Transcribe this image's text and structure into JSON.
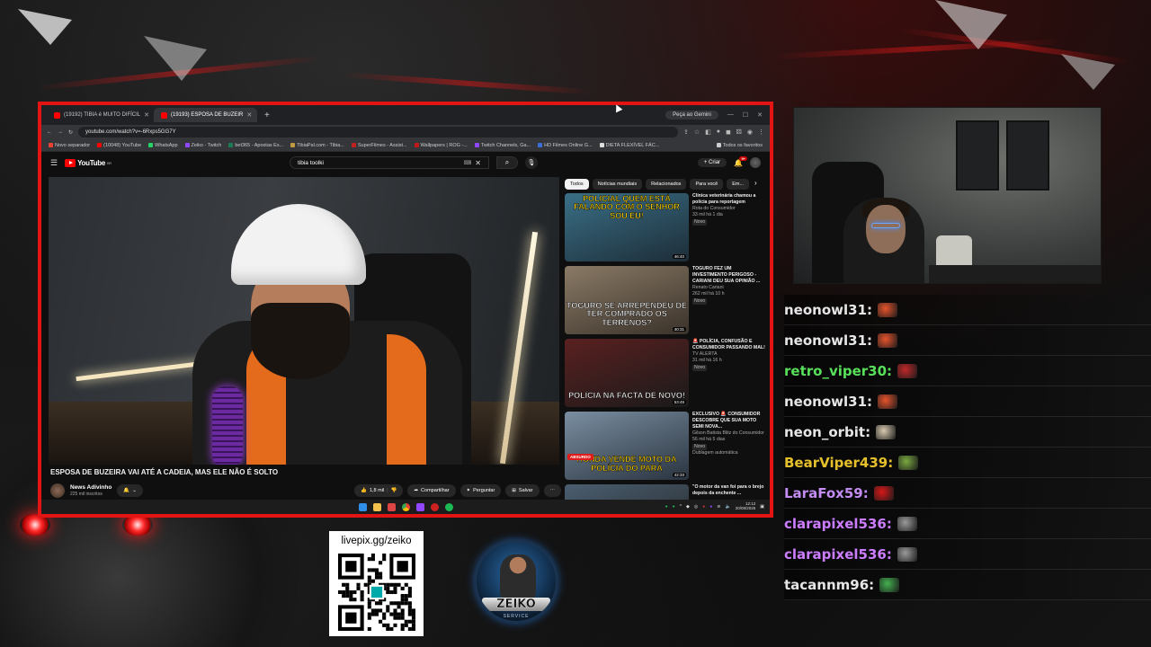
{
  "browser": {
    "tabs": [
      {
        "label": "(19192) TIBIA é MUITO DIFÍCIL",
        "active": false
      },
      {
        "label": "(19193) ESPOSA DE BUZEIR",
        "active": true
      }
    ],
    "gemini_label": "Peça ao Gemini",
    "url": "youtube.com/watch?v=-6Rxps5GG7Y",
    "bookmarks": [
      "Novo separador",
      "(10048) YouTube",
      "WhatsApp",
      "Zeiko - Twitch",
      "bet365 - Apostas Es...",
      "TibiaPal.com - Tibia...",
      "SuperFilmes - Assist...",
      "Wallpapers | ROG -...",
      "Twitch Channels, Ga...",
      "HD Filmes Online G...",
      "DIETA FLEXÍVEL FÁC..."
    ],
    "bookmarks_right": "Todos os favoritos"
  },
  "youtube": {
    "logo_text": "YouTube",
    "logo_sup": "BR",
    "search_value": "tibia toolki",
    "create_label": "Criar",
    "notif_count": "9+",
    "video_title": "ESPOSA DE BUZEIRA VAI ATÉ A CADEIA, MAS ELE NÃO É SOLTO",
    "channel_name": "News Adivinho",
    "channel_subs": "225 mil inscritos",
    "likes": "1,8 mil",
    "share_label": "Compartilhar",
    "ask_label": "Perguntar",
    "save_label": "Salvar",
    "chips": [
      "Todos",
      "Notícias mundiais",
      "Relacionados",
      "Para você",
      "Em..."
    ],
    "recs": [
      {
        "title": "Clínica veterinária chamou a polícia para reportagem",
        "channel": "Rota do Consumidor",
        "stats": "33 mil  há 1 dia",
        "badge": "Novo",
        "duration": "46:40",
        "caption": "POLICIAL QUEM ESTÁ FALANDO COM O SENHOR SOU EU!",
        "cap_top": true,
        "c1": "#3a6f86",
        "c2": "#1d2d38",
        "tag": ""
      },
      {
        "title": "TOGURO FEZ UM INVESTIMENTO PERIGOSO - CARIANI DEU SUA OPINIÃO ...",
        "channel": "Renato Cariani",
        "stats": "262 mil  há 10 h",
        "badge": "Novo",
        "duration": "40:31",
        "caption": "TOGURO SE ARREPENDEU DE TER COMPRADO OS TERRENOS?",
        "cap_top": false,
        "c1": "#8a7a66",
        "c2": "#3a322a",
        "tag": ""
      },
      {
        "title": "🚨 POLÍCIA, CONFUSÃO E CONSUMIDOR PASSANDO MAL!",
        "channel": "TV ALERTA",
        "stats": "31 mil  há 16 h",
        "badge": "Novo",
        "duration": "53:49",
        "caption": "POLÍCIA NA FACTA DE NOVO!",
        "cap_top": false,
        "c1": "#5a2020",
        "c2": "#1a1a1a",
        "tag": ""
      },
      {
        "title": "EXCLUSIVO 🚨 CONSUMIDOR DESCOBRE QUE SUA MOTO SEMI NOVA...",
        "channel": "Gilson Batista Blitz do Consumidor",
        "stats": "56 mil  há 5 dias",
        "badge": "Novo",
        "duration": "42:33",
        "caption": "HONDA VENDE MOTO DA POLÍCIA DO PARÁ",
        "cap_top": false,
        "c1": "#7a8ea0",
        "c2": "#2a3440",
        "tag": "ABSURDO"
      },
      {
        "title": "\"O motor da van foi para o brejo depois da enchente ...",
        "channel": "",
        "stats": "",
        "badge": "",
        "duration": "",
        "caption": "",
        "cap_top": false,
        "c1": "#4a5e70",
        "c2": "#222",
        "tag": ""
      }
    ],
    "dubbed_label": "Dublagem automática"
  },
  "taskbar": {
    "time": "12:12",
    "date": "20/08/2025"
  },
  "overlay": {
    "qr_url": "livepix.gg/zeiko",
    "logo_name": "ZEIKO",
    "logo_sub": "SERVICE"
  },
  "chat": [
    {
      "user": "neonowl31:",
      "color": "#e6e6e6",
      "emote_color": "#e5532c"
    },
    {
      "user": "neonowl31:",
      "color": "#e6e6e6",
      "emote_color": "#e5532c"
    },
    {
      "user": "retro_viper30:",
      "color": "#58e05a",
      "emote_color": "#c0282a"
    },
    {
      "user": "neonowl31:",
      "color": "#e6e6e6",
      "emote_color": "#e5532c"
    },
    {
      "user": "neon_orbit:",
      "color": "#e6e6e6",
      "emote_color": "#d9c9b0"
    },
    {
      "user": "BearViper439:",
      "color": "#e5c02a",
      "emote_color": "#7aa840"
    },
    {
      "user": "LaraFox59:",
      "color": "#c38cf2",
      "emote_color": "#d81818"
    },
    {
      "user": "clarapixel536:",
      "color": "#cc7dff",
      "emote_color": "#9a9a9a"
    },
    {
      "user": "clarapixel536:",
      "color": "#cc7dff",
      "emote_color": "#9a9a9a"
    },
    {
      "user": "tacannm96:",
      "color": "#e6e6e6",
      "emote_color": "#43b050"
    }
  ]
}
